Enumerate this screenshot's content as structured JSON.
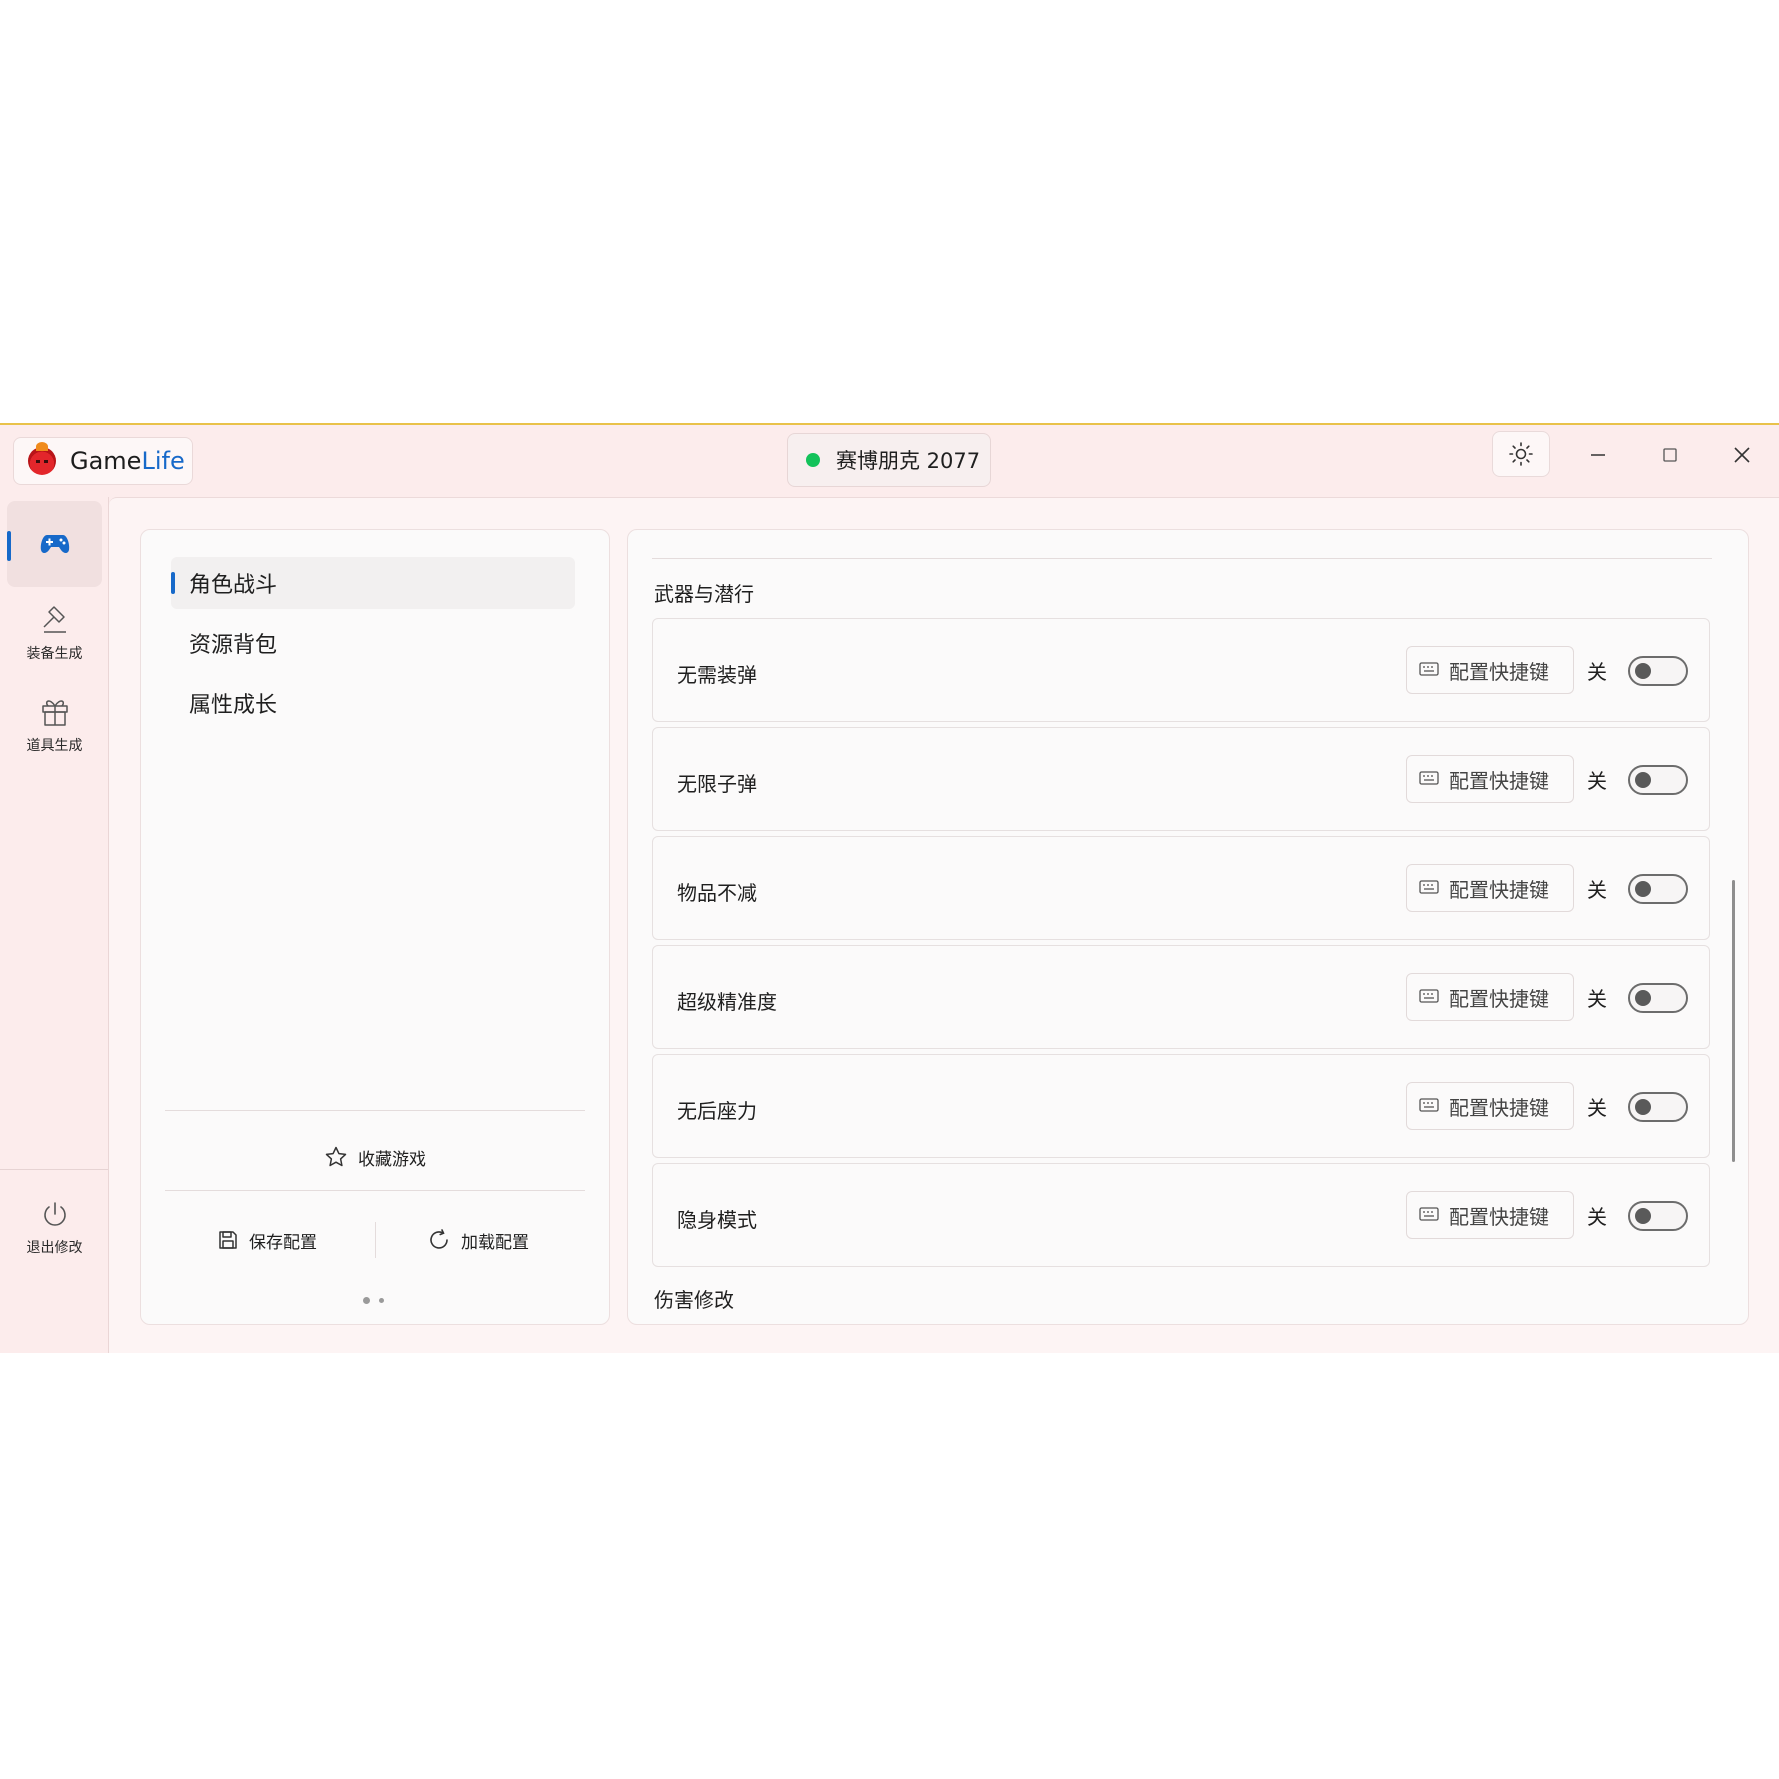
{
  "app": {
    "brand_game": "Game",
    "brand_life": "Life",
    "current_game": "赛博朋克 2077",
    "status_color": "#13c25a",
    "accent_color": "#1769c9"
  },
  "rail": {
    "items": [
      {
        "label": "",
        "icon": "gamepad-icon"
      },
      {
        "label": "装备生成",
        "icon": "hammer-icon"
      },
      {
        "label": "道具生成",
        "icon": "gift-icon"
      }
    ],
    "exit_label": "退出修改",
    "exit_icon": "power-icon"
  },
  "categories": [
    {
      "label": "角色战斗",
      "active": true
    },
    {
      "label": "资源背包",
      "active": false
    },
    {
      "label": "属性成长",
      "active": false
    }
  ],
  "left_panel": {
    "favorite_label": "收藏游戏",
    "save_label": "保存配置",
    "load_label": "加载配置"
  },
  "sections": [
    {
      "title": "武器与潜行"
    },
    {
      "title": "伤害修改"
    }
  ],
  "rows": [
    {
      "label": "无需装弹",
      "hotkey": "配置快捷键",
      "state": "关",
      "on": false
    },
    {
      "label": "无限子弹",
      "hotkey": "配置快捷键",
      "state": "关",
      "on": false
    },
    {
      "label": "物品不减",
      "hotkey": "配置快捷键",
      "state": "关",
      "on": false
    },
    {
      "label": "超级精准度",
      "hotkey": "配置快捷键",
      "state": "关",
      "on": false
    },
    {
      "label": "无后座力",
      "hotkey": "配置快捷键",
      "state": "关",
      "on": false
    },
    {
      "label": "隐身模式",
      "hotkey": "配置快捷键",
      "state": "关",
      "on": false
    }
  ]
}
